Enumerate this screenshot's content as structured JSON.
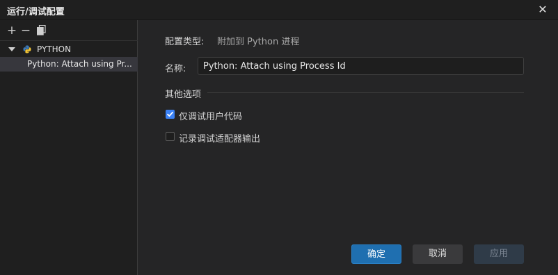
{
  "window": {
    "title": "运行/调试配置"
  },
  "sidebar": {
    "toolbar": {
      "add_label": "+",
      "remove_label": "−"
    },
    "group_label": "PYTHON",
    "items": [
      {
        "label": "Python: Attach using Pr..."
      }
    ]
  },
  "form": {
    "config_type_label": "配置类型:",
    "config_type_value": "附加到 Python 进程",
    "name_label": "名称:",
    "name_value": "Python: Attach using Process Id",
    "other_options_label": "其他选项",
    "options": [
      {
        "label": "仅调试用户代码",
        "checked": true
      },
      {
        "label": "记录调试适配器输出",
        "checked": false
      }
    ]
  },
  "footer": {
    "ok_label": "确定",
    "cancel_label": "取消",
    "apply_label": "应用",
    "apply_enabled": false
  },
  "colors": {
    "accent": "#3b82f6",
    "primary_button": "#1f6fb0",
    "background": "#252526"
  },
  "icons": [
    "close-icon",
    "plus-icon",
    "minus-icon",
    "copy-icon",
    "chevron-down-icon",
    "python-icon",
    "checkmark-icon"
  ]
}
